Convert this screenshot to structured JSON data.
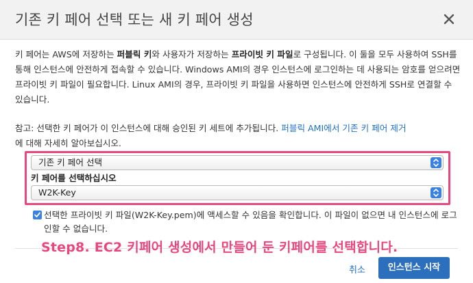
{
  "dialog": {
    "title": "기존 키 페어 선택 또는 새 키 페어 생성",
    "close_icon": "close-icon"
  },
  "intro": {
    "t1": "키 페어는 AWS에 저장하는 ",
    "b1": "퍼블릭 키",
    "t2": "와 사용자가 저장하는 ",
    "b2": "프라이빗 키 파일",
    "t3": "로 구성됩니다. 이 둘을 모두 사용하여 SSH를 통해 인스턴스에 안전하게 접속할 수 있습니다. Windows AMI의 경우 인스턴스에 로그인하는 데 사용되는 암호를 얻으려면 프라이빗 키 파일이 필요합니다. Linux AMI의 경우, 프라이빗 키 파일을 사용하면 인스턴스에 안전하게 SSH로 연결할 수 있습니다."
  },
  "note": {
    "text": "참고: 선택한 키 페어가 이 인스턴스에 대해 승인된 키 세트에 추가됩니다. ",
    "link": "퍼블릭 AMI에서 기존 키 페어 제거",
    "suffix": "에 대해 자세히 알아보십시오."
  },
  "form": {
    "mode_select": "기존 키 페어 선택",
    "keypair_label": "키 페어를 선택하십시오",
    "keypair_select": "W2K-Key",
    "ack_checked": true,
    "ack_text": "선택한 프라이빗 키 파일(W2K-Key.pem)에 액세스할 수 있음을 확인합니다. 이 파일이 없으면 내 인스턴스에 로그인할 수 없습니다."
  },
  "annotation": "Step8. EC2 키페어 생성에서 만들어 둔 키페어를 선택합니다.",
  "footer": {
    "cancel_label": "취소",
    "launch_label": "인스턴스 시작"
  },
  "colors": {
    "accent": "#2c6fbd",
    "link": "#1f6fbf",
    "highlight": "#e7477d"
  }
}
